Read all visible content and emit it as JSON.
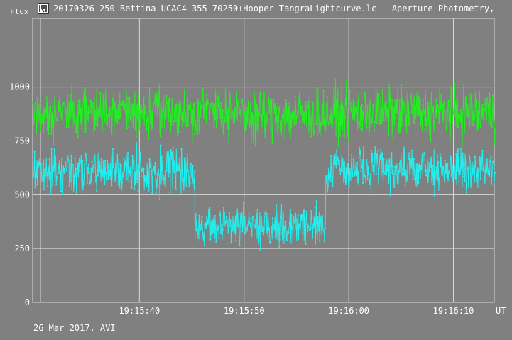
{
  "window": {
    "title": "20170326_250_Bettina_UCAC4_355-70250+Hooper_TangraLightcurve.lc - Aperture Photometry,",
    "icon": "lightcurve-app-icon"
  },
  "footer": {
    "date_label": "26 Mar 2017, AVI"
  },
  "colors": {
    "background": "#808080",
    "grid": "#d8d8d8",
    "series_green": "#22ee22",
    "series_cyan": "#22eeee",
    "text": "#ffffff"
  },
  "chart_data": {
    "type": "line",
    "title": "",
    "ylabel": "Flux",
    "xlabel": "UT",
    "ylim": [
      0,
      1200
    ],
    "y_ticks": [
      {
        "value": 0,
        "label": "0"
      },
      {
        "value": 250,
        "label": "250"
      },
      {
        "value": 500,
        "label": "500"
      },
      {
        "value": 750,
        "label": "750"
      },
      {
        "value": 1000,
        "label": "1000"
      }
    ],
    "x_range_seconds": [
      19.8,
      63.7
    ],
    "x_ticks": [
      {
        "value": 40,
        "label": "19:15:40"
      },
      {
        "value": 50,
        "label": "19:15:50"
      },
      {
        "value": 60,
        "label": "19:16:00"
      },
      {
        "value": 70,
        "label": "19:16:10"
      }
    ],
    "grid": true,
    "series": [
      {
        "color": "#22ee22",
        "segments": [
          {
            "x": [
              29.8,
              45.8
            ],
            "mean": 880,
            "jitter": 100
          },
          {
            "x": [
              45.8,
              48.0
            ],
            "mean": 900,
            "jitter": 80
          },
          {
            "x": [
              48.0,
              58.6
            ],
            "mean": 870,
            "jitter": 110
          },
          {
            "x": [
              58.6,
              74.0
            ],
            "mean": 880,
            "jitter": 110
          }
        ]
      },
      {
        "color": "#22eeee",
        "segments": [
          {
            "x": [
              29.8,
              45.3
            ],
            "mean": 610,
            "jitter": 95
          },
          {
            "x": [
              45.3,
              57.8
            ],
            "mean": 360,
            "jitter": 85
          },
          {
            "x": [
              57.8,
              74.0
            ],
            "mean": 615,
            "jitter": 90
          }
        ]
      }
    ]
  }
}
